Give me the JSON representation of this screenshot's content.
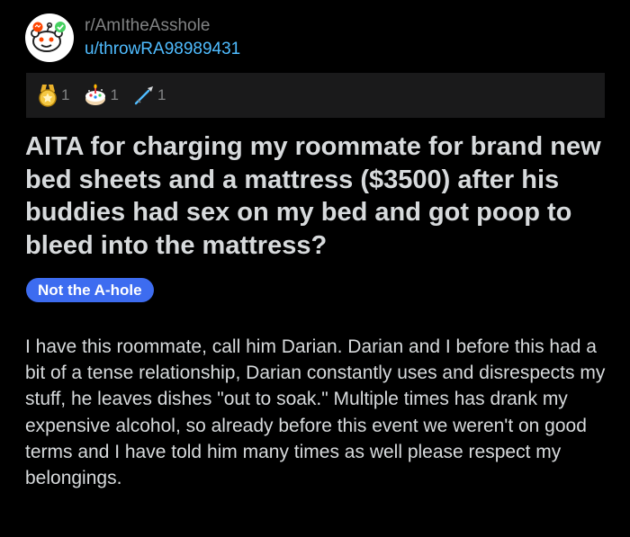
{
  "post": {
    "subreddit": "r/AmItheAsshole",
    "author": "u/throwRA98989431",
    "title": "AITA for charging my roommate for brand new bed sheets and a mattress ($3500) after his buddies had sex on my bed and got poop to bleed into the mattress?",
    "flair": "Not the A-hole",
    "body": "I have this roommate, call him Darian. Darian and I before this had a bit of a tense relationship, Darian constantly uses and disrespects my stuff, he leaves dishes \"out to soak.\" Multiple times has drank my expensive alcohol, so already before this event we weren't on good terms and I have told him many times as well please respect my belongings."
  },
  "awards": [
    {
      "icon": "gold-medal-icon",
      "count": "1"
    },
    {
      "icon": "cake-award-icon",
      "count": "1"
    },
    {
      "icon": "spear-award-icon",
      "count": "1"
    }
  ],
  "colors": {
    "background": "#000000",
    "awards_bar": "#1a1a1b",
    "text": "#d7dadc",
    "muted": "#818384",
    "link": "#4fbcff",
    "flair": "#3d6cf0"
  }
}
